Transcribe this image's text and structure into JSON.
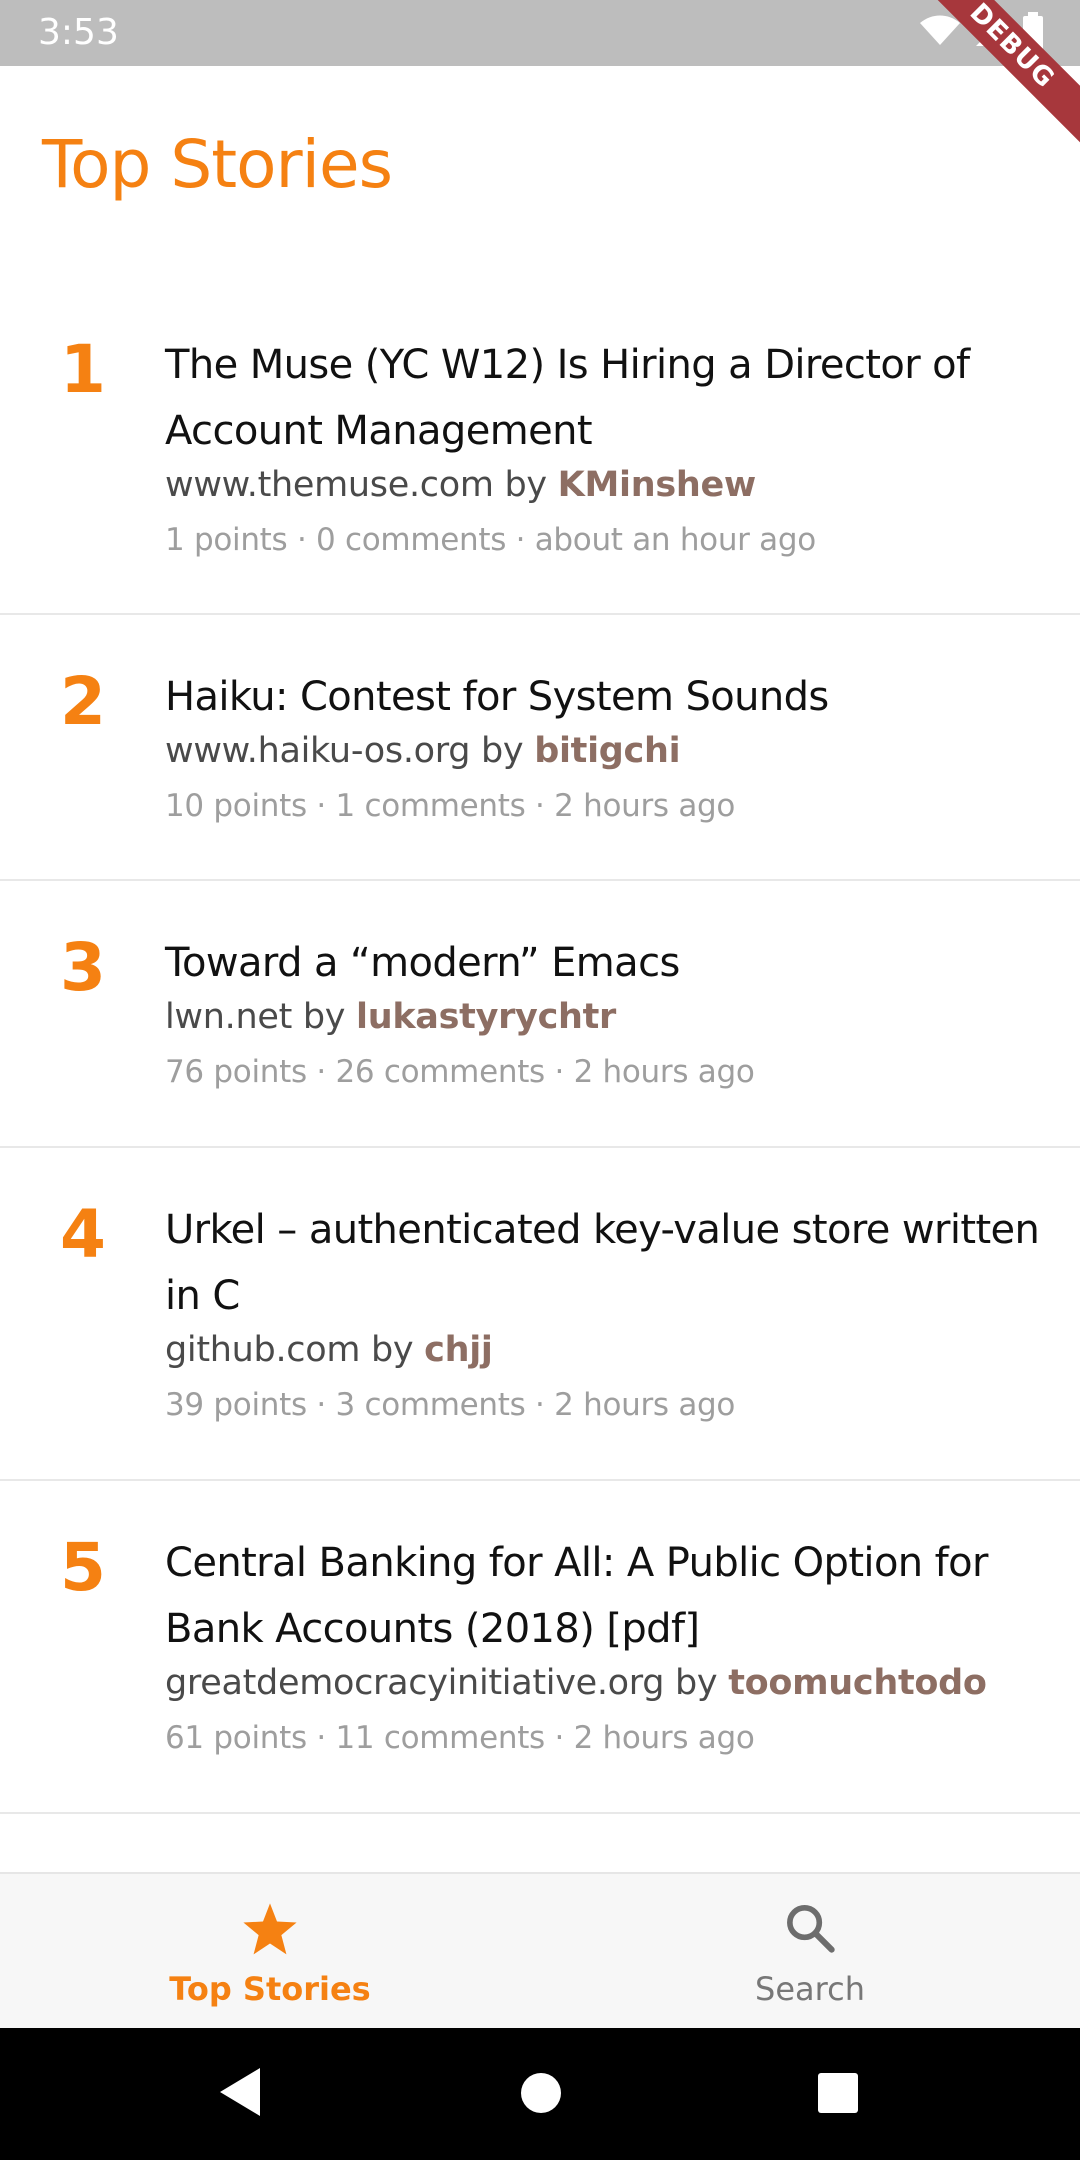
{
  "status_bar": {
    "time": "3:53",
    "debug_banner": "DEBUG"
  },
  "header": {
    "title": "Top Stories"
  },
  "stories": [
    {
      "rank": "1",
      "title": "The Muse (YC W12) Is Hiring a Director of Account Management",
      "domain": "www.themuse.com",
      "by": "by",
      "author": "KMinshew",
      "stats": "1 points · 0 comments · about an hour ago"
    },
    {
      "rank": "2",
      "title": "Haiku: Contest for System Sounds",
      "domain": "www.haiku-os.org",
      "by": "by",
      "author": "bitigchi",
      "stats": "10 points · 1 comments · 2 hours ago"
    },
    {
      "rank": "3",
      "title": "Toward a “modern” Emacs",
      "domain": "lwn.net",
      "by": "by",
      "author": "lukastyrychtr",
      "stats": "76 points · 26 comments · 2 hours ago"
    },
    {
      "rank": "4",
      "title": "Urkel – authenticated key-value store written in C",
      "domain": "github.com",
      "by": "by",
      "author": "chjj",
      "stats": "39 points · 3 comments · 2 hours ago"
    },
    {
      "rank": "5",
      "title": "Central Banking for All: A Public Option for Bank Accounts (2018) [pdf]",
      "domain": "greatdemocracyinitiative.org",
      "by": "by",
      "author": "toomuchtodo",
      "stats": "61 points · 11 comments · 2 hours ago"
    }
  ],
  "bottom_nav": {
    "items": [
      {
        "label": "Top Stories",
        "icon": "star-icon",
        "active": true
      },
      {
        "label": "Search",
        "icon": "search-icon",
        "active": false
      }
    ]
  },
  "colors": {
    "accent": "#f58112",
    "author": "#8d6e63",
    "meta": "#9e9e9e",
    "status_bar": "#bdbdbd",
    "debug_banner": "#a7373c"
  }
}
